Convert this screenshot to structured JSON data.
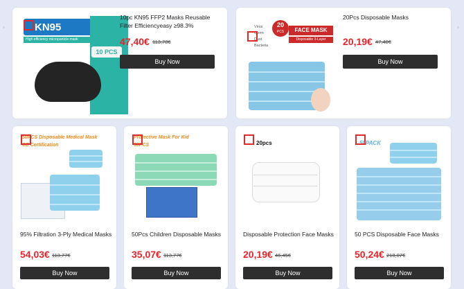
{
  "buy_label": "Buy Now",
  "products_top": [
    {
      "title": "10pc KN95 FFP2 Masks Reusable Filter Efficiencyeasy ≥98.3%",
      "price": "47,40€",
      "old_price": "113,78€",
      "badge": "KN95",
      "badge_sub": "10 PCS",
      "strip": "High efficiency microparticle mask"
    },
    {
      "title": "20Pcs Disposable Masks",
      "price": "20,19€",
      "old_price": "47,40€",
      "badge": "FACE MASK",
      "badge_sub": "Disposable 3-Layer",
      "count": "20",
      "count_unit": "PCS",
      "bullets": [
        "Virus",
        "Germ",
        "Dust",
        "Bacteria"
      ]
    }
  ],
  "products_bottom": [
    {
      "title": "95% Filtration 3-Ply Medical Masks",
      "price": "54,03€",
      "old_price": "113,77€",
      "overlay1": "50PCS Disposable Medical Mask",
      "overlay2": "CE Certification"
    },
    {
      "title": "50Pcs Children Disposable Masks",
      "price": "35,07€",
      "old_price": "113,77€",
      "overlay1": "Protective Mask For Kid",
      "overlay2": "50PCS"
    },
    {
      "title": "Disposable Protection Face Masks",
      "price": "20,19€",
      "old_price": "46,45€",
      "overlay1": "20pcs"
    },
    {
      "title": "50 PCS Disposable Face Masks",
      "price": "50,24€",
      "old_price": "218,07€",
      "overlay1": "50PACK"
    }
  ],
  "colors": {
    "price": "#e8232a",
    "button": "#2e2e2e",
    "background": "#e4e7f5",
    "accent_teal": "#2bb3a6"
  }
}
